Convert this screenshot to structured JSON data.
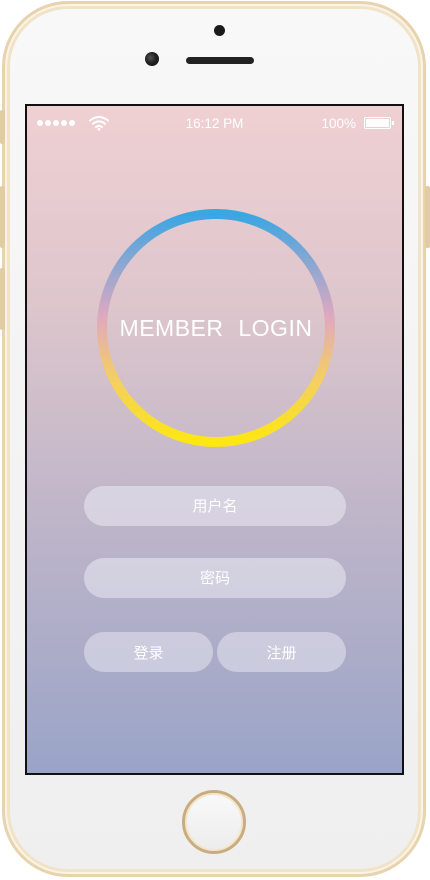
{
  "status_bar": {
    "time": "16:12 PM",
    "battery": "100%"
  },
  "hero": {
    "title": "MEMBER  LOGIN"
  },
  "form": {
    "username_placeholder": "用户名",
    "password_placeholder": "密码",
    "login_label": "登录",
    "register_label": "注册"
  },
  "icons": [
    "signal-dots-icon",
    "wifi-icon",
    "battery-icon",
    "home-button-icon"
  ],
  "colors": {
    "ring_top": "#3aa6e2",
    "ring_bottom": "#fde712",
    "screen_top": "#efd0d3",
    "screen_bottom": "#9aa4c8",
    "phone_trim": "#e7d3ad"
  }
}
